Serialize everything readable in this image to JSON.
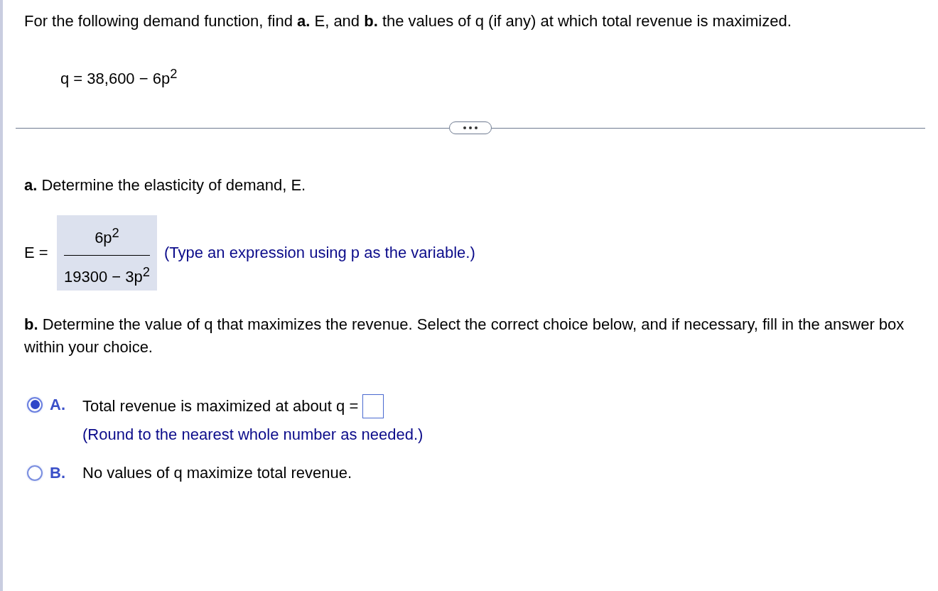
{
  "intro": "For the following demand function, find **a.** E, and **b.** the values of q (if any) at which total revenue is maximized.",
  "equation": "q = 38,600 − 6p$^{2}$",
  "part_a": {
    "prompt": "**a.** Determine the elasticity of demand, E.",
    "lhs": "E =",
    "numerator": "6p$^{2}$",
    "denominator": "19300 − 3p$^{2}$",
    "hint": "(Type an expression using p as the variable.)"
  },
  "part_b": {
    "prompt": "**b.** Determine the value of q that maximizes the revenue. Select the correct choice below, and if necessary, fill in the answer box within your choice.",
    "choices": [
      {
        "letter": "A.",
        "text": "Total revenue is maximized at about q =",
        "kind": "input",
        "hint": "(Round to the nearest whole number as needed.)",
        "selected": true
      },
      {
        "letter": "B.",
        "text": "No values of q maximize total revenue.",
        "kind": "plain",
        "selected": false
      }
    ]
  }
}
